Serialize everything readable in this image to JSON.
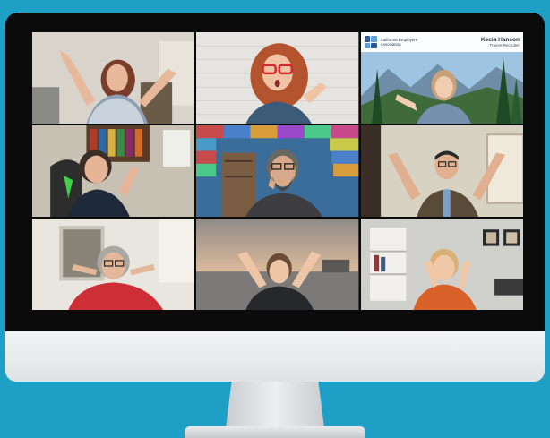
{
  "video_call": {
    "layout": "gallery-3x3",
    "participant_count": 9,
    "virtual_background": {
      "organization": "California Employers Association",
      "presenter_name": "Kecia Hanson",
      "presenter_title": "Trainer/Recruiter"
    }
  },
  "colors": {
    "page_background": "#1e9fc6",
    "bezel": "#0b0b0c",
    "chin": "#eceff1"
  }
}
